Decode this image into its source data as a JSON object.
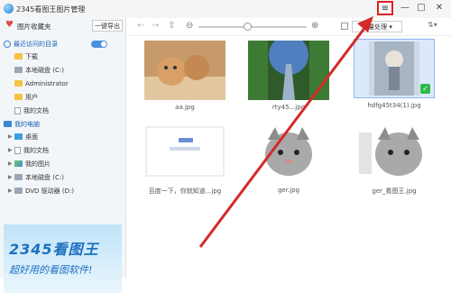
{
  "app": {
    "title": "2345看图王图片管理"
  },
  "titlebar": {
    "menu_icon": "≡",
    "minimize_icon": "—",
    "maximize_icon": "□",
    "close_icon": "✕"
  },
  "sidebar": {
    "favorites_label": "图片收藏夹",
    "export_label": "一键导出",
    "recent_title": "最近访问的目录",
    "recent_items": [
      "下载",
      "本地磁盘 (C:)",
      "Administrator",
      "用户",
      "我的文档"
    ],
    "computer_title": "我的电脑",
    "computer_items": [
      "桌面",
      "我的文档",
      "我的图片",
      "本地磁盘 (C:)",
      "DVD 驱动器 (D:)"
    ]
  },
  "banner": {
    "brand": "2345看图王",
    "slogan": "超好用的看图软件!"
  },
  "toolbar": {
    "batch_label": "批量处理 ▾"
  },
  "thumbnails": [
    {
      "name": "aa.jpg"
    },
    {
      "name": "rty45...jpg"
    },
    {
      "name": "hdfg45t34(1).jpg"
    },
    {
      "name": "百度一下，你就知道...jpg"
    },
    {
      "name": "ger.jpg"
    },
    {
      "name": "ger_看图王.jpg"
    }
  ],
  "colors": {
    "accent": "#1a5fb4",
    "highlight_box": "#dd2222",
    "arrow": "#d42a2a"
  }
}
